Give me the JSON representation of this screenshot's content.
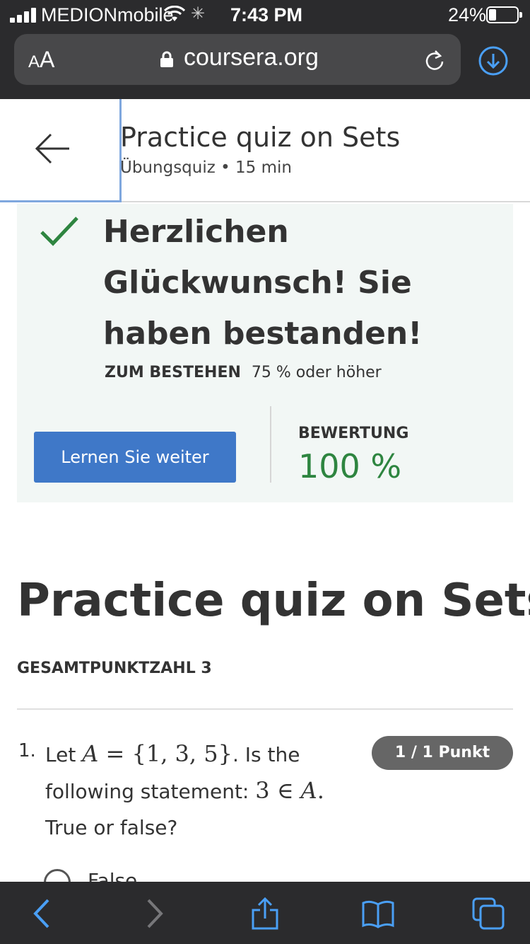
{
  "status_bar": {
    "carrier": "MEDIONmobile",
    "time": "7:43 PM",
    "battery_percent": "24%",
    "battery_level": 0.24
  },
  "browser": {
    "text_size_small": "A",
    "text_size_large": "A",
    "domain": "coursera.org",
    "icons": [
      "lock-icon",
      "reload-icon",
      "download-icon"
    ]
  },
  "header": {
    "title": "Practice quiz on Sets",
    "subtitle": "Übungsquiz • 15 min"
  },
  "result": {
    "congrats": "Herzlichen Glückwunsch! Sie haben bestanden!",
    "pass_label": "ZUM BESTEHEN",
    "pass_value": "75 % oder höher",
    "continue_button": "Lernen Sie weiter",
    "grade_label": "BEWERTUNG",
    "grade_value": "100 %",
    "accent_color": "#2e8540",
    "button_color": "#3f78c8"
  },
  "quiz": {
    "title": "Practice quiz on Sets",
    "total_score": "GESAMTPUNKTZAHL 3",
    "questions": [
      {
        "number": "1.",
        "text_before": "Let",
        "set_var": "A",
        "set_eq": " = {1, 3, 5}",
        "text_mid": ". Is the following statement:",
        "statement_num": "3 ∈ ",
        "statement_var": "A",
        "statement_end": ".",
        "text_after": "True or false?",
        "points": "1 / 1 Punkt",
        "options": [
          "False"
        ]
      }
    ]
  },
  "toolbar": {
    "icons": [
      "back-icon",
      "forward-icon",
      "share-icon",
      "bookmarks-icon",
      "tabs-icon"
    ]
  }
}
